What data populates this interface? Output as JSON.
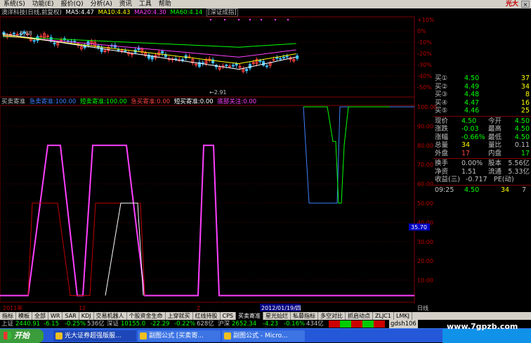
{
  "menu": {
    "items": [
      "系统(S)",
      "功能(E)",
      "报价(Q)",
      "分析(A)",
      "资讯",
      "工具",
      "帮助"
    ],
    "brand": "光大"
  },
  "main_header": {
    "stock_name": "澳洋科技(日线,前复权)",
    "ma5_label": "MA5:4.47",
    "ma10_label": "MA10:4.43",
    "ma20_label": "MA20:4.30",
    "ma60_label": "MA60:4.14",
    "index_tag": "[深证成指]",
    "ma5_color": "#ffffff",
    "ma10_color": "#ffff00",
    "ma20_color": "#ff40ff",
    "ma60_color": "#00ff00",
    "high_annotation": "6.68",
    "low_annotation": "←2.91",
    "right_labels": [
      "+10%",
      "0%",
      "-10%",
      "-20%",
      "-30%",
      "-40%",
      "-50%"
    ]
  },
  "indicator_header": {
    "name": "买卖寄准",
    "items": [
      {
        "label": "急卖寄准:100.00",
        "color": "#4080ff"
      },
      {
        "label": "短卖寄准:100.00",
        "color": "#00ff00"
      },
      {
        "label": "急买寄准:0.00",
        "color": "#ff4040"
      },
      {
        "label": "短买寄准:0.00",
        "color": "#ffffff"
      },
      {
        "label": "底部关注:0.00",
        "color": "#ff40ff"
      }
    ]
  },
  "indicator_axis": [
    "100.00",
    "90.00",
    "80.00",
    "70.00",
    "60.00",
    "50.00",
    "40.00",
    "30.00",
    "20.00",
    "10.00"
  ],
  "indicator_cursor_value": "35.70",
  "date_axis": {
    "left_year": "2011年",
    "mark1": "12",
    "mark2": "2",
    "cursor_date": "2012/01/19/四",
    "period": "日线"
  },
  "quote_panel": {
    "bids": [
      {
        "label": "买①",
        "price": "4.50",
        "vol": "37"
      },
      {
        "label": "买②",
        "price": "4.49",
        "vol": "34"
      },
      {
        "label": "买③",
        "price": "4.48",
        "vol": "8"
      },
      {
        "label": "买④",
        "price": "4.47",
        "vol": "16"
      },
      {
        "label": "买⑤",
        "price": "4.46",
        "vol": "25"
      }
    ],
    "stats": [
      {
        "l1": "现价",
        "v1": "4.50",
        "l2": "今开",
        "v2": "4.50"
      },
      {
        "l1": "涨跌",
        "v1": "-0.03",
        "l2": "最高",
        "v2": "4.50"
      },
      {
        "l1": "涨幅",
        "v1": "-0.66%",
        "l2": "最低",
        "v2": "4.50"
      },
      {
        "l1": "总量",
        "v1": "34",
        "l2": "量比",
        "v2": "0.11"
      },
      {
        "l1": "外盘",
        "v1": "17",
        "l2": "内盘",
        "v2": "17"
      }
    ],
    "stats2": [
      {
        "l1": "换手",
        "v1": "0.00%",
        "l2": "股本",
        "v2": "5.56亿"
      },
      {
        "l1": "净资",
        "v1": "1.51",
        "l2": "流通",
        "v2": "5.33亿"
      }
    ],
    "eps": {
      "label": "收益(三)",
      "value": "-0.717",
      "pe": "PE(动)"
    },
    "tick": {
      "time": "09:25",
      "price": "4.50",
      "vol": "34",
      "num": "7"
    }
  },
  "bottom_tabs": [
    "指标",
    "模板",
    "全部",
    "WR",
    "SAR",
    "KDJ",
    "交易机器人",
    "个股资金生命",
    "上穿就买",
    "红线持股",
    "CPS",
    "买卖寄准",
    "星光灿烂",
    "私募指标",
    "多空对比",
    "抓启动点",
    "ZLJC1",
    "LMKJ"
  ],
  "active_tab": "买卖寄准",
  "status": {
    "sh_label": "上证",
    "sh_value": "2440.91",
    "sh_change": "-6.15",
    "sh_pct": "-0.25%",
    "sh_amt": "536亿",
    "sz_label": "深证",
    "sz_value": "10155.0",
    "sz_change": "-22.29",
    "sz_pct": "-0.22%",
    "sz_amt": "628亿",
    "hs_label": "沪深",
    "hs_value": "2652.34",
    "hs_change": "-4.23",
    "hs_pct": "-0.16%",
    "hs_amt": "434亿",
    "server": "gdsh106"
  },
  "taskbar": {
    "start": "开始",
    "tasks": [
      "光大证券超强版服...",
      "副图公式 [买卖寄...",
      "副图公式 - Micro..."
    ]
  },
  "watermark": "www.7gpzb.com"
}
